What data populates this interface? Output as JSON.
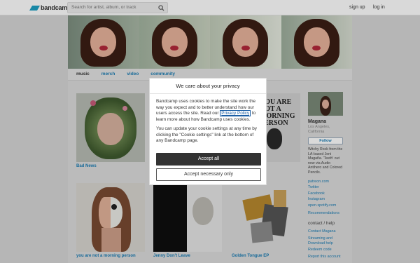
{
  "topbar": {
    "logo_text": "bandcamp",
    "search_placeholder": "Search for artist, album, or track",
    "signup": "sign up",
    "login": "log in"
  },
  "tabs": [
    {
      "label": "music"
    },
    {
      "label": "merch"
    },
    {
      "label": "video"
    },
    {
      "label": "community"
    }
  ],
  "albums": [
    {
      "title": "Bad News",
      "icon": "leafy-wreath-portrait"
    },
    {
      "title": "",
      "icon": "portrait"
    },
    {
      "title": "",
      "icon": "portrait"
    },
    {
      "title": "morning person",
      "icon": "text-art-portrait",
      "art_text": "YOU ARE NOT A MORNING PERSON"
    },
    {
      "title": "you are not a morning person",
      "icon": "half-face-portrait"
    },
    {
      "title": "Jenny Don't Leave",
      "icon": "split-portrait"
    },
    {
      "title": "Golden Tongue EP",
      "icon": "collage-art"
    }
  ],
  "artist": {
    "name": "Magana",
    "location": "Los Angeles, California",
    "follow_label": "Follow",
    "bio": "Witchy Rock from the LA-based Jeni Magaña. 'Teeth' out now via Audio Antihero and Colored Pencils.",
    "links": [
      "patreon.com",
      "Twitter",
      "Facebook",
      "Instagram",
      "open.spotify.com"
    ],
    "recommendations": "Recommendations",
    "contact_heading": "contact / help",
    "contact_links": [
      "Contact Magana",
      "Streaming and Download help",
      "Redeem code",
      "Report this account"
    ]
  },
  "privacy_dialog": {
    "title": "We care about your privacy",
    "body_part1": "Bandcamp uses cookies to make the site work the way you expect and to better understand how our users access the site. Read our ",
    "privacy_link": "Privacy Policy",
    "body_part2": " to learn more about how Bandcamp uses cookies.",
    "body_2": "You can update your cookie settings at any time by clicking the \"Cookie settings\" link at the bottom of any Bandcamp page.",
    "accept_all": "Accept all",
    "accept_necessary": "Accept necessary only"
  },
  "colors": {
    "accent": "#1c7db4",
    "logo": "#1da0c3",
    "button_dark": "#333333"
  }
}
